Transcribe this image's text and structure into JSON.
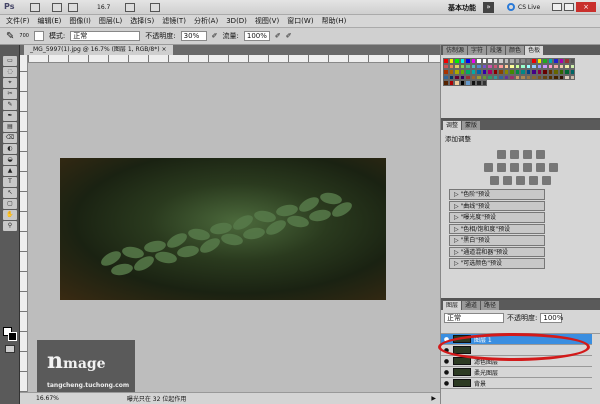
{
  "appbar": {
    "zoom": "16.7",
    "workspace": "基本功能",
    "cs_live": "CS Live"
  },
  "menu": [
    "文件(F)",
    "编辑(E)",
    "图像(I)",
    "图层(L)",
    "选择(S)",
    "滤镜(T)",
    "分析(A)",
    "3D(D)",
    "视图(V)",
    "窗口(W)",
    "帮助(H)"
  ],
  "options": {
    "brush_size": "700",
    "mode_label": "模式:",
    "mode_value": "正常",
    "opacity_label": "不透明度:",
    "opacity_value": "30%",
    "flow_label": "流量:",
    "flow_value": "100%"
  },
  "document": {
    "tab_title": "_MG_5997(1).jpg @ 16.7% (图层 1, RGB/8*)",
    "close": "×"
  },
  "status": {
    "zoom": "16.67%",
    "message": "曝光只在 32 位起作用"
  },
  "watermark": {
    "logo": "nmage",
    "url": "tangcheng.tuchong.com"
  },
  "swatch_panel": {
    "tabs": [
      "仿制源",
      "字符",
      "段落",
      "颜色",
      "色板"
    ],
    "active": 4,
    "colors": [
      "#e00",
      "#ee0",
      "#0e0",
      "#0ee",
      "#00e",
      "#e0e",
      "#fff",
      "#fff",
      "#eee",
      "#ddd",
      "#ccc",
      "#bbb",
      "#aaa",
      "#999",
      "#888",
      "#777",
      "#e00",
      "#ee0",
      "#2a2",
      "#0aa",
      "#22c",
      "#a0a",
      "#933",
      "#555",
      "#c55",
      "#d85",
      "#dc6",
      "#8c5",
      "#5b8",
      "#5bb",
      "#58c",
      "#75c",
      "#c5a",
      "#c57",
      "#f99",
      "#fc9",
      "#ff9",
      "#cf9",
      "#9fc",
      "#9ff",
      "#9cf",
      "#99f",
      "#c9f",
      "#f9c",
      "#eaa",
      "#eca",
      "#eea",
      "#cea",
      "#a30",
      "#a60",
      "#aa0",
      "#6a0",
      "#0a6",
      "#0aa",
      "#06a",
      "#30a",
      "#a06",
      "#800",
      "#840",
      "#880",
      "#480",
      "#084",
      "#088",
      "#048",
      "#408",
      "#804",
      "#600",
      "#630",
      "#660",
      "#360",
      "#063",
      "#066",
      "#369",
      "#036",
      "#603",
      "#306",
      "#933",
      "#963",
      "#993",
      "#693",
      "#396",
      "#399",
      "#369",
      "#639",
      "#936",
      "#c96",
      "#a85",
      "#974",
      "#863",
      "#752",
      "#641",
      "#530",
      "#420",
      "#310",
      "#dcb",
      "#cba",
      "#520",
      "#a00",
      "#ec9",
      "#000",
      "#69c",
      "#111",
      "#222",
      "#333"
    ]
  },
  "adjust_panel": {
    "tabs": [
      "调整",
      "蒙版"
    ],
    "title": "添加调整",
    "presets": [
      "\"色阶\"预设",
      "\"曲线\"预设",
      "\"曝光度\"预设",
      "\"色相/饱和度\"预设",
      "\"黑白\"预设",
      "\"通道混和器\"预设",
      "\"可选颜色\"预设"
    ]
  },
  "layers_panel": {
    "tabs": [
      "图层",
      "通道",
      "路径"
    ],
    "blend": "正常",
    "opacity_label": "不透明度:",
    "opacity_value": "100%",
    "layers": [
      {
        "name": "图层 1",
        "selected": true
      },
      {
        "name": "",
        "selected": false
      },
      {
        "name": "滤色图层",
        "selected": false
      },
      {
        "name": "柔光图层",
        "selected": false
      },
      {
        "name": "背景",
        "selected": false
      }
    ]
  },
  "colors": {
    "highlight": "#3a8ee0",
    "annotation": "#d21a1a"
  }
}
